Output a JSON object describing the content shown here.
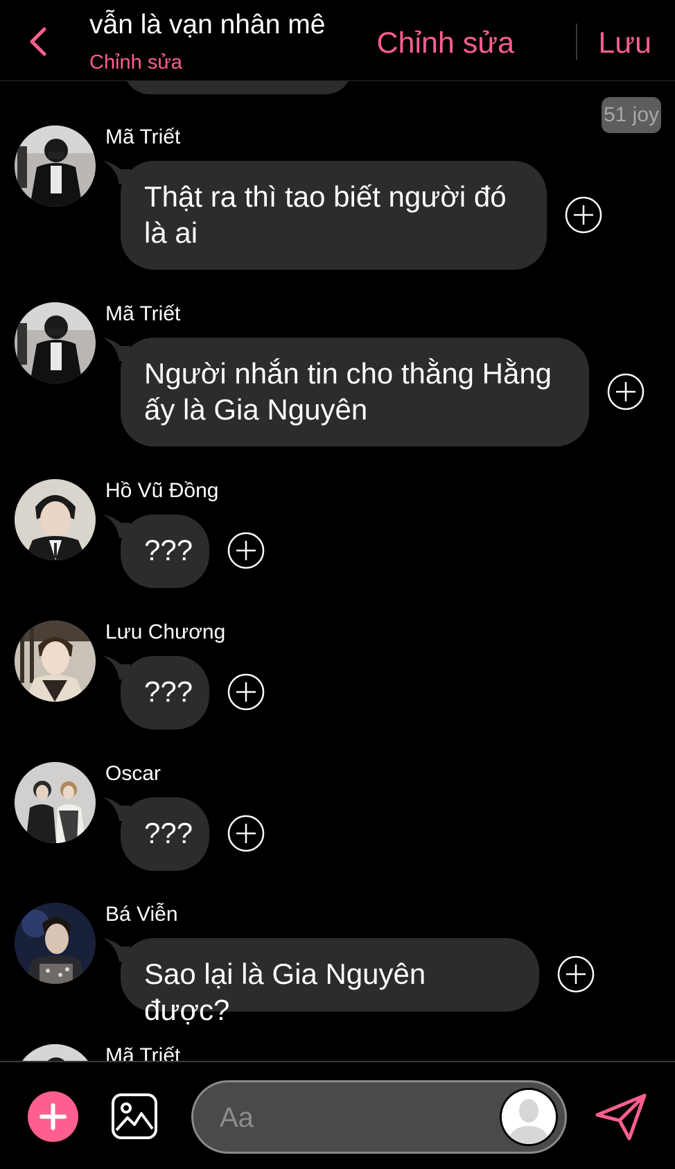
{
  "theme": {
    "accent": "#ff5f8f",
    "bubble": "#2c2c2e",
    "background": "#000000"
  },
  "header": {
    "back_icon": "chevron-left-icon",
    "title": "vẫn là vạn nhân mê",
    "subtitle": "Chỉnh sửa",
    "edit_label": "Chỉnh sửa",
    "save_label": "Lưu"
  },
  "badge": {
    "text": "51 joy"
  },
  "messages": [
    {
      "sender": "Mã Triết",
      "lines": [
        "Thật ra thì tao biết người đó",
        "là ai"
      ]
    },
    {
      "sender": "Mã Triết",
      "lines": [
        "Người nhắn tin cho thằng Hằng",
        "ấy là Gia Nguyên"
      ]
    },
    {
      "sender": "Hồ Vũ Đồng",
      "lines": [
        "???"
      ]
    },
    {
      "sender": "Lưu Chương",
      "lines": [
        "???"
      ]
    },
    {
      "sender": "Oscar",
      "lines": [
        "???"
      ]
    },
    {
      "sender": "Bá Viễn",
      "lines": [
        "Sao lại là Gia Nguyên được?"
      ]
    },
    {
      "sender": "Mã Triết",
      "lines": []
    }
  ],
  "composer": {
    "placeholder": "Aa",
    "add_icon": "plus-icon",
    "image_icon": "image-icon",
    "send_icon": "send-icon"
  }
}
